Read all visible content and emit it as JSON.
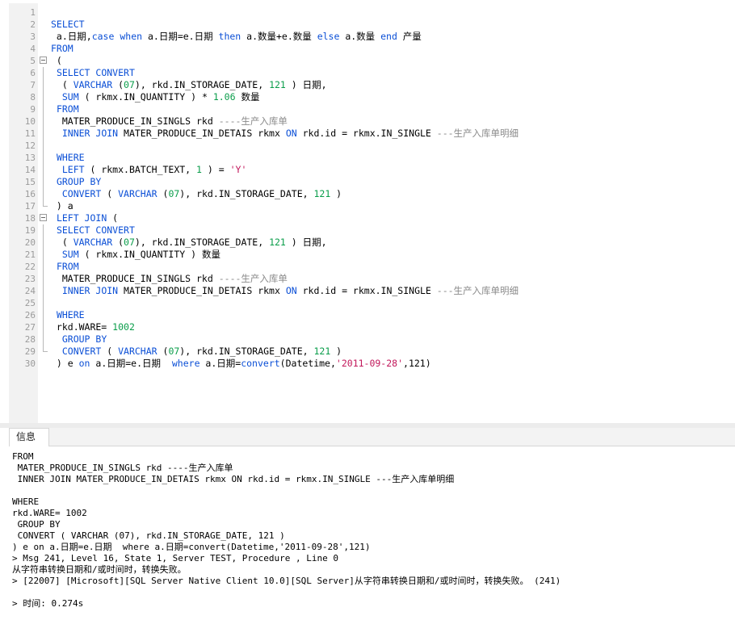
{
  "tabs": {
    "info": "信息"
  },
  "editor_lines": [
    {
      "n": "1",
      "t": []
    },
    {
      "n": "2",
      "t": [
        {
          "c": "kw",
          "v": "SELECT"
        }
      ]
    },
    {
      "n": "3",
      "t": [
        {
          "c": "",
          "v": " a.日期,"
        },
        {
          "c": "kw",
          "v": "case"
        },
        {
          "c": "",
          "v": " "
        },
        {
          "c": "kw",
          "v": "when"
        },
        {
          "c": "",
          "v": " a.日期=e.日期 "
        },
        {
          "c": "kw",
          "v": "then"
        },
        {
          "c": "",
          "v": " a.数量+e.数量 "
        },
        {
          "c": "kw",
          "v": "else"
        },
        {
          "c": "",
          "v": " a.数量 "
        },
        {
          "c": "kw",
          "v": "end"
        },
        {
          "c": "",
          "v": " 产量"
        }
      ]
    },
    {
      "n": "4",
      "t": [
        {
          "c": "kw",
          "v": "FROM"
        }
      ]
    },
    {
      "n": "5",
      "t": [
        {
          "c": "",
          "v": " ("
        }
      ]
    },
    {
      "n": "6",
      "t": [
        {
          "c": "",
          "v": " "
        },
        {
          "c": "kw",
          "v": "SELECT CONVERT"
        }
      ]
    },
    {
      "n": "7",
      "t": [
        {
          "c": "",
          "v": "  ( "
        },
        {
          "c": "kw",
          "v": "VARCHAR"
        },
        {
          "c": "",
          "v": " ("
        },
        {
          "c": "nm",
          "v": "07"
        },
        {
          "c": "",
          "v": "), rkd.IN_STORAGE_DATE, "
        },
        {
          "c": "nm",
          "v": "121"
        },
        {
          "c": "",
          "v": " ) 日期,"
        }
      ]
    },
    {
      "n": "8",
      "t": [
        {
          "c": "",
          "v": "  "
        },
        {
          "c": "kw",
          "v": "SUM"
        },
        {
          "c": "",
          "v": " ( rkmx.IN_QUANTITY ) * "
        },
        {
          "c": "nm",
          "v": "1.06"
        },
        {
          "c": "",
          "v": " 数量"
        }
      ]
    },
    {
      "n": "9",
      "t": [
        {
          "c": "",
          "v": " "
        },
        {
          "c": "kw",
          "v": "FROM"
        }
      ]
    },
    {
      "n": "10",
      "t": [
        {
          "c": "",
          "v": "  MATER_PRODUCE_IN_SINGLS rkd "
        },
        {
          "c": "cm",
          "v": "----生产入库单"
        }
      ]
    },
    {
      "n": "11",
      "t": [
        {
          "c": "",
          "v": "  "
        },
        {
          "c": "kw",
          "v": "INNER JOIN"
        },
        {
          "c": "",
          "v": " MATER_PRODUCE_IN_DETAIS rkmx "
        },
        {
          "c": "kw",
          "v": "ON"
        },
        {
          "c": "",
          "v": " rkd.id = rkmx.IN_SINGLE "
        },
        {
          "c": "cm",
          "v": "---生产入库单明细"
        }
      ]
    },
    {
      "n": "12",
      "t": []
    },
    {
      "n": "13",
      "t": [
        {
          "c": "",
          "v": " "
        },
        {
          "c": "kw",
          "v": "WHERE"
        }
      ]
    },
    {
      "n": "14",
      "t": [
        {
          "c": "",
          "v": "  "
        },
        {
          "c": "kw",
          "v": "LEFT"
        },
        {
          "c": "",
          "v": " ( rkmx.BATCH_TEXT, "
        },
        {
          "c": "nm",
          "v": "1"
        },
        {
          "c": "",
          "v": " ) = "
        },
        {
          "c": "st",
          "v": "'Y'"
        }
      ]
    },
    {
      "n": "15",
      "t": [
        {
          "c": "",
          "v": " "
        },
        {
          "c": "kw",
          "v": "GROUP BY"
        }
      ]
    },
    {
      "n": "16",
      "t": [
        {
          "c": "",
          "v": "  "
        },
        {
          "c": "kw",
          "v": "CONVERT"
        },
        {
          "c": "",
          "v": " ( "
        },
        {
          "c": "kw",
          "v": "VARCHAR"
        },
        {
          "c": "",
          "v": " ("
        },
        {
          "c": "nm",
          "v": "07"
        },
        {
          "c": "",
          "v": "), rkd.IN_STORAGE_DATE, "
        },
        {
          "c": "nm",
          "v": "121"
        },
        {
          "c": "",
          "v": " )"
        }
      ]
    },
    {
      "n": "17",
      "t": [
        {
          "c": "",
          "v": " ) a"
        }
      ]
    },
    {
      "n": "18",
      "t": [
        {
          "c": "",
          "v": " "
        },
        {
          "c": "kw",
          "v": "LEFT JOIN"
        },
        {
          "c": "",
          "v": " ("
        }
      ]
    },
    {
      "n": "19",
      "t": [
        {
          "c": "",
          "v": " "
        },
        {
          "c": "kw",
          "v": "SELECT CONVERT"
        }
      ]
    },
    {
      "n": "20",
      "t": [
        {
          "c": "",
          "v": "  ( "
        },
        {
          "c": "kw",
          "v": "VARCHAR"
        },
        {
          "c": "",
          "v": " ("
        },
        {
          "c": "nm",
          "v": "07"
        },
        {
          "c": "",
          "v": "), rkd.IN_STORAGE_DATE, "
        },
        {
          "c": "nm",
          "v": "121"
        },
        {
          "c": "",
          "v": " ) 日期,"
        }
      ]
    },
    {
      "n": "21",
      "t": [
        {
          "c": "",
          "v": "  "
        },
        {
          "c": "kw",
          "v": "SUM"
        },
        {
          "c": "",
          "v": " ( rkmx.IN_QUANTITY ) 数量"
        }
      ]
    },
    {
      "n": "22",
      "t": [
        {
          "c": "",
          "v": " "
        },
        {
          "c": "kw",
          "v": "FROM"
        }
      ]
    },
    {
      "n": "23",
      "t": [
        {
          "c": "",
          "v": "  MATER_PRODUCE_IN_SINGLS rkd "
        },
        {
          "c": "cm",
          "v": "----生产入库单"
        }
      ]
    },
    {
      "n": "24",
      "t": [
        {
          "c": "",
          "v": "  "
        },
        {
          "c": "kw",
          "v": "INNER JOIN"
        },
        {
          "c": "",
          "v": " MATER_PRODUCE_IN_DETAIS rkmx "
        },
        {
          "c": "kw",
          "v": "ON"
        },
        {
          "c": "",
          "v": " rkd.id = rkmx.IN_SINGLE "
        },
        {
          "c": "cm",
          "v": "---生产入库单明细"
        }
      ]
    },
    {
      "n": "25",
      "t": []
    },
    {
      "n": "26",
      "t": [
        {
          "c": "",
          "v": " "
        },
        {
          "c": "kw",
          "v": "WHERE"
        }
      ]
    },
    {
      "n": "27",
      "t": [
        {
          "c": "",
          "v": " rkd.WARE= "
        },
        {
          "c": "nm",
          "v": "1002"
        }
      ]
    },
    {
      "n": "28",
      "t": [
        {
          "c": "",
          "v": "  "
        },
        {
          "c": "kw",
          "v": "GROUP BY"
        }
      ]
    },
    {
      "n": "29",
      "t": [
        {
          "c": "",
          "v": "  "
        },
        {
          "c": "kw",
          "v": "CONVERT"
        },
        {
          "c": "",
          "v": " ( "
        },
        {
          "c": "kw",
          "v": "VARCHAR"
        },
        {
          "c": "",
          "v": " ("
        },
        {
          "c": "nm",
          "v": "07"
        },
        {
          "c": "",
          "v": "), rkd.IN_STORAGE_DATE, "
        },
        {
          "c": "nm",
          "v": "121"
        },
        {
          "c": "",
          "v": " )"
        }
      ]
    },
    {
      "n": "30",
      "t": [
        {
          "c": "",
          "v": " ) e "
        },
        {
          "c": "kw",
          "v": "on"
        },
        {
          "c": "",
          "v": " a.日期=e.日期  "
        },
        {
          "c": "kw",
          "v": "where"
        },
        {
          "c": "",
          "v": " a.日期="
        },
        {
          "c": "kw",
          "v": "convert"
        },
        {
          "c": "",
          "v": "(Datetime,"
        },
        {
          "c": "st",
          "v": "'2011-09-28'"
        },
        {
          "c": "",
          "v": ",121)"
        }
      ]
    }
  ],
  "output_lines": [
    "FROM",
    " MATER_PRODUCE_IN_SINGLS rkd ----生产入库单",
    " INNER JOIN MATER_PRODUCE_IN_DETAIS rkmx ON rkd.id = rkmx.IN_SINGLE ---生产入库单明细",
    "",
    "WHERE",
    "rkd.WARE= 1002",
    " GROUP BY",
    " CONVERT ( VARCHAR (07), rkd.IN_STORAGE_DATE, 121 )",
    ") e on a.日期=e.日期  where a.日期=convert(Datetime,'2011-09-28',121)",
    "> Msg 241, Level 16, State 1, Server TEST, Procedure , Line 0",
    "从字符串转换日期和/或时间时，转换失败。",
    "> [22007] [Microsoft][SQL Server Native Client 10.0][SQL Server]从字符串转换日期和/或时间时，转换失败。 (241)",
    "",
    "> 时间: 0.274s"
  ]
}
